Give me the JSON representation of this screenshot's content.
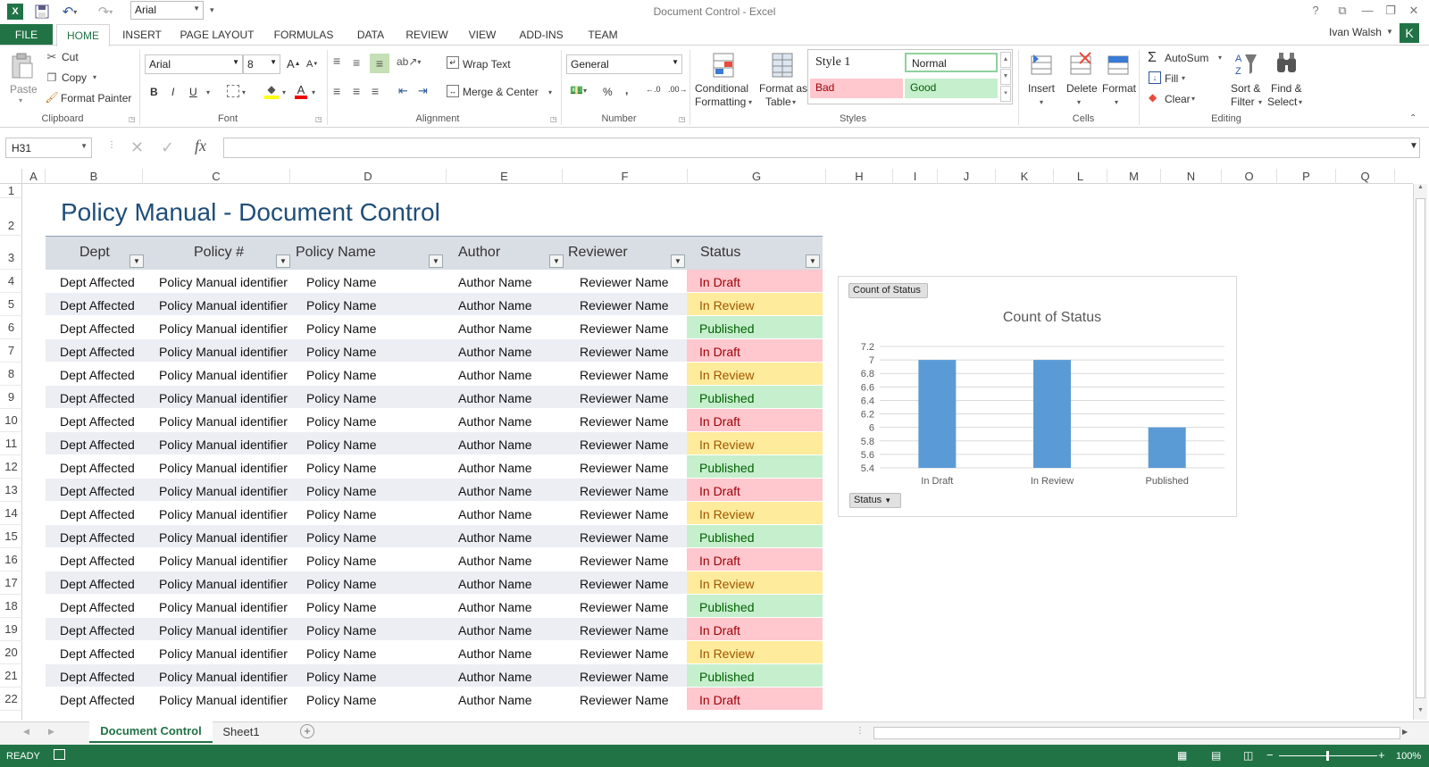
{
  "window": {
    "title": "Document Control - Excel",
    "user": "Ivan Walsh",
    "avatar_letter": "K"
  },
  "qat": {
    "font_name": "Arial"
  },
  "tabs": [
    "FILE",
    "HOME",
    "INSERT",
    "PAGE LAYOUT",
    "FORMULAS",
    "DATA",
    "REVIEW",
    "VIEW",
    "ADD-INS",
    "TEAM"
  ],
  "ribbon": {
    "clipboard": {
      "paste": "Paste",
      "cut": "Cut",
      "copy": "Copy",
      "format_painter": "Format Painter",
      "label": "Clipboard"
    },
    "font": {
      "name": "Arial",
      "size": "8",
      "label": "Font",
      "bold": "B",
      "italic": "I",
      "underline": "U"
    },
    "alignment": {
      "wrap": "Wrap Text",
      "merge": "Merge & Center",
      "label": "Alignment"
    },
    "number": {
      "format": "General",
      "label": "Number",
      "percent": "%",
      "comma": ","
    },
    "styles": {
      "cond1": "Conditional",
      "cond2": "Formatting",
      "fat1": "Format as",
      "fat2": "Table",
      "style1": "Style 1",
      "normal": "Normal",
      "bad": "Bad",
      "good": "Good",
      "label": "Styles"
    },
    "cells": {
      "insert": "Insert",
      "delete": "Delete",
      "format": "Format",
      "label": "Cells"
    },
    "editing": {
      "autosum": "AutoSum",
      "fill": "Fill",
      "clear": "Clear",
      "sort1": "Sort &",
      "sort2": "Filter",
      "find1": "Find &",
      "find2": "Select",
      "label": "Editing"
    }
  },
  "formula_bar": {
    "name_box": "H31",
    "fx": "fx",
    "formula": ""
  },
  "columns": [
    "A",
    "B",
    "C",
    "D",
    "E",
    "F",
    "G",
    "H",
    "I",
    "J",
    "K",
    "L",
    "M",
    "N",
    "O",
    "P",
    "Q"
  ],
  "rows": [
    "1",
    "2",
    "3",
    "4",
    "5",
    "6",
    "7",
    "8",
    "9",
    "10",
    "11",
    "12",
    "13",
    "14",
    "15",
    "16",
    "17",
    "18",
    "19",
    "20",
    "21",
    "22"
  ],
  "sheet": {
    "title": "Policy Manual - Document Control"
  },
  "table": {
    "headers": [
      "Dept",
      "Policy #",
      "Policy Name",
      "Author",
      "Reviewer",
      "Status"
    ],
    "rows": [
      [
        "Dept Affected",
        "Policy Manual identifier",
        "Policy Name",
        "Author Name",
        "Reviewer Name",
        "In Draft"
      ],
      [
        "Dept Affected",
        "Policy Manual identifier",
        "Policy Name",
        "Author Name",
        "Reviewer Name",
        "In Review"
      ],
      [
        "Dept Affected",
        "Policy Manual identifier",
        "Policy Name",
        "Author Name",
        "Reviewer Name",
        "Published"
      ],
      [
        "Dept Affected",
        "Policy Manual identifier",
        "Policy Name",
        "Author Name",
        "Reviewer Name",
        "In Draft"
      ],
      [
        "Dept Affected",
        "Policy Manual identifier",
        "Policy Name",
        "Author Name",
        "Reviewer Name",
        "In Review"
      ],
      [
        "Dept Affected",
        "Policy Manual identifier",
        "Policy Name",
        "Author Name",
        "Reviewer Name",
        "Published"
      ],
      [
        "Dept Affected",
        "Policy Manual identifier",
        "Policy Name",
        "Author Name",
        "Reviewer Name",
        "In Draft"
      ],
      [
        "Dept Affected",
        "Policy Manual identifier",
        "Policy Name",
        "Author Name",
        "Reviewer Name",
        "In Review"
      ],
      [
        "Dept Affected",
        "Policy Manual identifier",
        "Policy Name",
        "Author Name",
        "Reviewer Name",
        "Published"
      ],
      [
        "Dept Affected",
        "Policy Manual identifier",
        "Policy Name",
        "Author Name",
        "Reviewer Name",
        "In Draft"
      ],
      [
        "Dept Affected",
        "Policy Manual identifier",
        "Policy Name",
        "Author Name",
        "Reviewer Name",
        "In Review"
      ],
      [
        "Dept Affected",
        "Policy Manual identifier",
        "Policy Name",
        "Author Name",
        "Reviewer Name",
        "Published"
      ],
      [
        "Dept Affected",
        "Policy Manual identifier",
        "Policy Name",
        "Author Name",
        "Reviewer Name",
        "In Draft"
      ],
      [
        "Dept Affected",
        "Policy Manual identifier",
        "Policy Name",
        "Author Name",
        "Reviewer Name",
        "In Review"
      ],
      [
        "Dept Affected",
        "Policy Manual identifier",
        "Policy Name",
        "Author Name",
        "Reviewer Name",
        "Published"
      ],
      [
        "Dept Affected",
        "Policy Manual identifier",
        "Policy Name",
        "Author Name",
        "Reviewer Name",
        "In Draft"
      ],
      [
        "Dept Affected",
        "Policy Manual identifier",
        "Policy Name",
        "Author Name",
        "Reviewer Name",
        "In Review"
      ],
      [
        "Dept Affected",
        "Policy Manual identifier",
        "Policy Name",
        "Author Name",
        "Reviewer Name",
        "Published"
      ],
      [
        "Dept Affected",
        "Policy Manual identifier",
        "Policy Name",
        "Author Name",
        "Reviewer Name",
        "In Draft"
      ]
    ]
  },
  "chart_data": {
    "type": "bar",
    "title": "Count of Status",
    "field_button": "Count of Status",
    "axis_button": "Status",
    "categories": [
      "In Draft",
      "In Review",
      "Published"
    ],
    "values": [
      7,
      7,
      6
    ],
    "ylim": [
      5.4,
      7.2
    ],
    "yticks": [
      "5.4",
      "5.6",
      "5.8",
      "6",
      "6.2",
      "6.4",
      "6.6",
      "6.8",
      "7",
      "7.2"
    ],
    "grid": true,
    "bar_color": "#5b9bd5"
  },
  "sheet_tabs": {
    "active": "Document Control",
    "other": "Sheet1"
  },
  "status_bar": {
    "ready": "READY",
    "zoom": "100%"
  },
  "colors": {
    "accent": "#217346",
    "title_blue": "#1f4e79"
  }
}
